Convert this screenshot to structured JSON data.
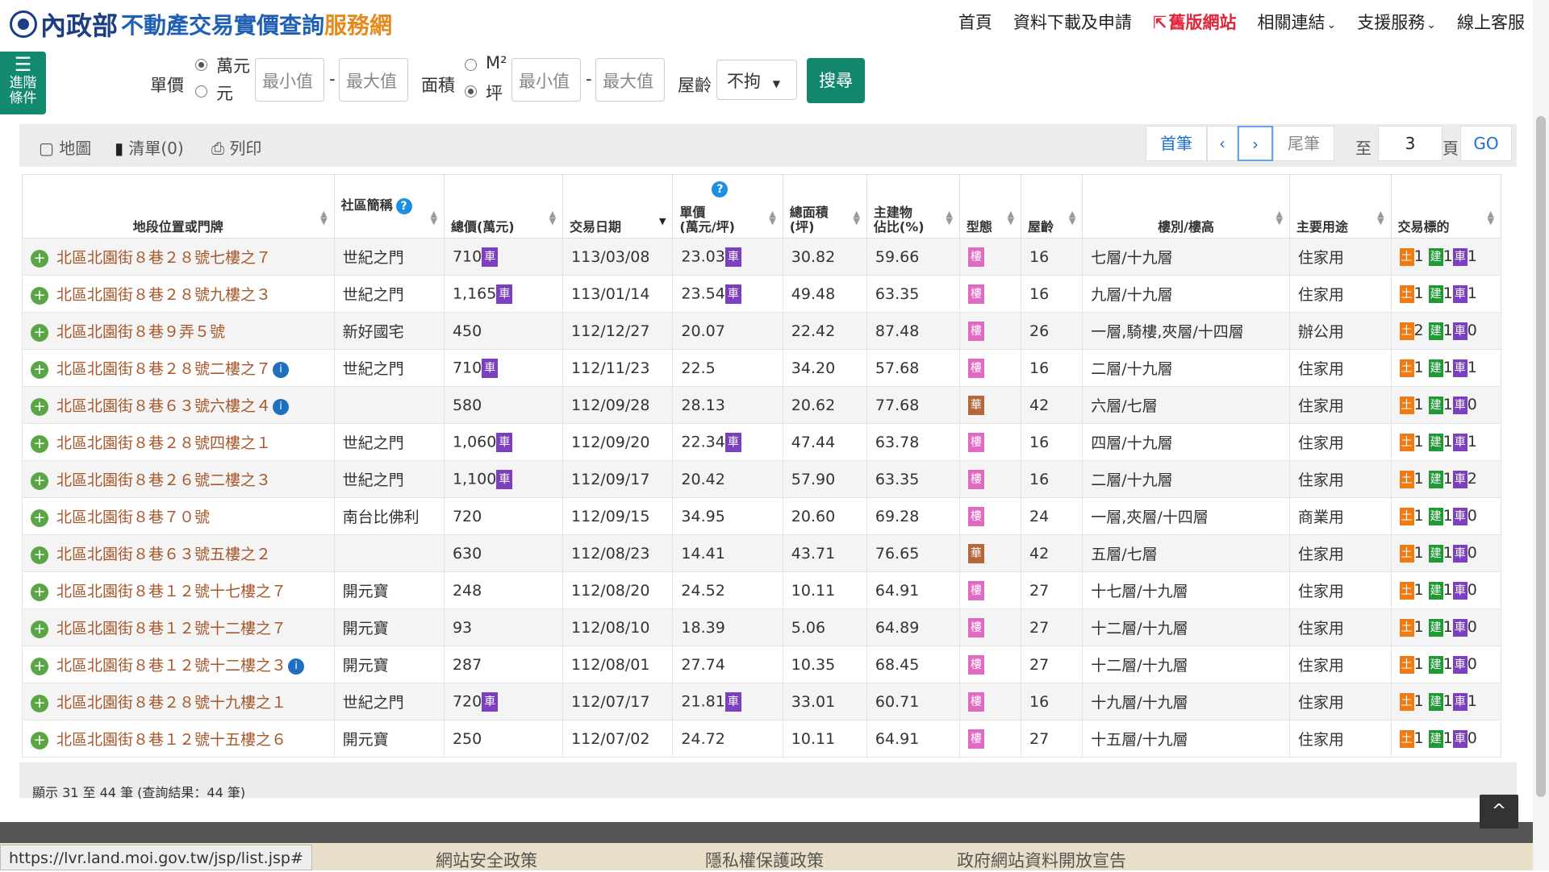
{
  "header": {
    "org": "內政部",
    "site_title_a": "不動產交易實價查詢",
    "site_title_b": "服務網",
    "nav": [
      "首頁",
      "資料下載及申請",
      "舊版網站",
      "相關連結",
      "支援服務",
      "線上客服"
    ]
  },
  "advanced": {
    "label": "進階條件"
  },
  "filters": {
    "unit_price_label": "單價",
    "unit_price_options": [
      "萬元",
      "元"
    ],
    "min_placeholder": "最小值",
    "max_placeholder": "最大值",
    "dash": "-",
    "area_label": "面積",
    "area_options": [
      "M²",
      "坪"
    ],
    "age_label": "屋齡",
    "age_value": "不拘",
    "search_label": "搜尋"
  },
  "toolbar": {
    "map": "地圖",
    "list": "清單(0)",
    "print": "列印",
    "first": "首筆",
    "prev": "‹",
    "next": "›",
    "last": "尾筆",
    "to": "至",
    "page": "3",
    "page_unit": "頁",
    "go": "GO"
  },
  "table": {
    "headers": [
      "地段位置或門牌",
      "社區簡稱",
      "總價(萬元)",
      "交易日期",
      "單價\n(萬元/坪)",
      "總面積\n(坪)",
      "主建物\n佔比(%)",
      "型態",
      "屋齡",
      "樓別/樓高",
      "主要用途",
      "交易標的"
    ],
    "rows": [
      {
        "addr": "北區北園街８巷２８號七樓之７",
        "info": false,
        "community": "世紀之門",
        "total": "710",
        "total_car": true,
        "date": "113/03/08",
        "unit": "23.03",
        "unit_car": true,
        "area": "30.82",
        "ratio": "59.66",
        "type": "樓",
        "age": "16",
        "floor": "七層/十九層",
        "use": "住家用",
        "land": "1",
        "bld": "1",
        "car": "1"
      },
      {
        "addr": "北區北園街８巷２８號九樓之３",
        "info": false,
        "community": "世紀之門",
        "total": "1,165",
        "total_car": true,
        "date": "113/01/14",
        "unit": "23.54",
        "unit_car": true,
        "area": "49.48",
        "ratio": "63.35",
        "type": "樓",
        "age": "16",
        "floor": "九層/十九層",
        "use": "住家用",
        "land": "1",
        "bld": "1",
        "car": "1"
      },
      {
        "addr": "北區北園街８巷９弄５號",
        "info": false,
        "community": "新好國宅",
        "total": "450",
        "total_car": false,
        "date": "112/12/27",
        "unit": "20.07",
        "unit_car": false,
        "area": "22.42",
        "ratio": "87.48",
        "type": "樓",
        "age": "26",
        "floor": "一層,騎樓,夾層/十四層",
        "use": "辦公用",
        "land": "2",
        "bld": "1",
        "car": "0"
      },
      {
        "addr": "北區北園街８巷２８號二樓之７",
        "info": true,
        "community": "世紀之門",
        "total": "710",
        "total_car": true,
        "date": "112/11/23",
        "unit": "22.5",
        "unit_car": false,
        "area": "34.20",
        "ratio": "57.68",
        "type": "樓",
        "age": "16",
        "floor": "二層/十九層",
        "use": "住家用",
        "land": "1",
        "bld": "1",
        "car": "1"
      },
      {
        "addr": "北區北園街８巷６３號六樓之４",
        "info": true,
        "community": "",
        "total": "580",
        "total_car": false,
        "date": "112/09/28",
        "unit": "28.13",
        "unit_car": false,
        "area": "20.62",
        "ratio": "77.68",
        "type": "華",
        "age": "42",
        "floor": "六層/七層",
        "use": "住家用",
        "land": "1",
        "bld": "1",
        "car": "0"
      },
      {
        "addr": "北區北園街８巷２８號四樓之１",
        "info": false,
        "community": "世紀之門",
        "total": "1,060",
        "total_car": true,
        "date": "112/09/20",
        "unit": "22.34",
        "unit_car": true,
        "area": "47.44",
        "ratio": "63.78",
        "type": "樓",
        "age": "16",
        "floor": "四層/十九層",
        "use": "住家用",
        "land": "1",
        "bld": "1",
        "car": "1"
      },
      {
        "addr": "北區北園街８巷２６號二樓之３",
        "info": false,
        "community": "世紀之門",
        "total": "1,100",
        "total_car": true,
        "date": "112/09/17",
        "unit": "20.42",
        "unit_car": false,
        "area": "57.90",
        "ratio": "63.35",
        "type": "樓",
        "age": "16",
        "floor": "二層/十九層",
        "use": "住家用",
        "land": "1",
        "bld": "1",
        "car": "2"
      },
      {
        "addr": "北區北園街８巷７０號",
        "info": false,
        "community": "南台比佛利",
        "total": "720",
        "total_car": false,
        "date": "112/09/15",
        "unit": "34.95",
        "unit_car": false,
        "area": "20.60",
        "ratio": "69.28",
        "type": "樓",
        "age": "24",
        "floor": "一層,夾層/十四層",
        "use": "商業用",
        "land": "1",
        "bld": "1",
        "car": "0"
      },
      {
        "addr": "北區北園街８巷６３號五樓之２",
        "info": false,
        "community": "",
        "total": "630",
        "total_car": false,
        "date": "112/08/23",
        "unit": "14.41",
        "unit_car": false,
        "area": "43.71",
        "ratio": "76.65",
        "type": "華",
        "age": "42",
        "floor": "五層/七層",
        "use": "住家用",
        "land": "1",
        "bld": "1",
        "car": "0"
      },
      {
        "addr": "北區北園街８巷１２號十七樓之７",
        "info": false,
        "community": "開元寶",
        "total": "248",
        "total_car": false,
        "date": "112/08/20",
        "unit": "24.52",
        "unit_car": false,
        "area": "10.11",
        "ratio": "64.91",
        "type": "樓",
        "age": "27",
        "floor": "十七層/十九層",
        "use": "住家用",
        "land": "1",
        "bld": "1",
        "car": "0"
      },
      {
        "addr": "北區北園街８巷１２號十二樓之７",
        "info": false,
        "community": "開元寶",
        "total": "93",
        "total_car": false,
        "date": "112/08/10",
        "unit": "18.39",
        "unit_car": false,
        "area": "5.06",
        "ratio": "64.89",
        "type": "樓",
        "age": "27",
        "floor": "十二層/十九層",
        "use": "住家用",
        "land": "1",
        "bld": "1",
        "car": "0"
      },
      {
        "addr": "北區北園街８巷１２號十二樓之３",
        "info": true,
        "community": "開元寶",
        "total": "287",
        "total_car": false,
        "date": "112/08/01",
        "unit": "27.74",
        "unit_car": false,
        "area": "10.35",
        "ratio": "68.45",
        "type": "樓",
        "age": "27",
        "floor": "十二層/十九層",
        "use": "住家用",
        "land": "1",
        "bld": "1",
        "car": "0"
      },
      {
        "addr": "北區北園街８巷２８號十九樓之１",
        "info": false,
        "community": "世紀之門",
        "total": "720",
        "total_car": true,
        "date": "112/07/17",
        "unit": "21.81",
        "unit_car": true,
        "area": "33.01",
        "ratio": "60.71",
        "type": "樓",
        "age": "16",
        "floor": "十九層/十九層",
        "use": "住家用",
        "land": "1",
        "bld": "1",
        "car": "1"
      },
      {
        "addr": "北區北園街８巷１２號十五樓之６",
        "info": false,
        "community": "開元寶",
        "total": "250",
        "total_car": false,
        "date": "112/07/02",
        "unit": "24.72",
        "unit_car": false,
        "area": "10.11",
        "ratio": "64.91",
        "type": "樓",
        "age": "27",
        "floor": "十五層/十九層",
        "use": "住家用",
        "land": "1",
        "bld": "1",
        "car": "0"
      }
    ],
    "badges": {
      "car": "車",
      "land": "土",
      "bld": "建",
      "car_target": "車"
    },
    "type_colors": {
      "樓": "#e06ac1",
      "華": "#b5673c"
    }
  },
  "result_summary": "顯示 31 至 44 筆 (查詢結果：44 筆)",
  "footer": {
    "links": [
      "網站安全政策",
      "隱私權保護政策",
      "政府網站資料開放宣告"
    ]
  },
  "status_url": "https://lvr.land.moi.gov.tw/jsp/list.jsp#",
  "icons": {
    "scroll_top": "^"
  }
}
